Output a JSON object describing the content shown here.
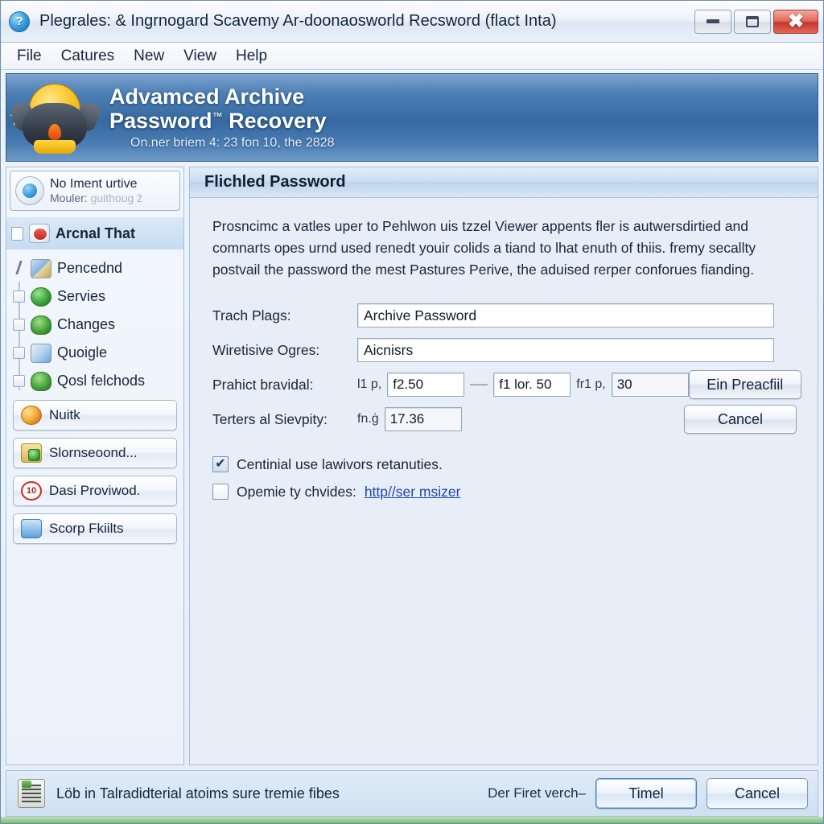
{
  "window": {
    "title": "Plegrales: & Ingrnogard Scavemy Ar-doonaosworld Recsword (flact Inta)",
    "app_icon": "question-mark-icon",
    "minimize_label": "Minimize",
    "restore_label": "Restore",
    "close_label": "Close"
  },
  "menu": {
    "items": [
      {
        "label": "File"
      },
      {
        "label": "Catures"
      },
      {
        "label": "New"
      },
      {
        "label": "View"
      },
      {
        "label": "Help"
      }
    ]
  },
  "banner": {
    "line1": "Advamced Archive",
    "line2": "Password",
    "trademark": "™",
    "line2_tail": " Recovery",
    "subtitle": "On.ner briem 4: 23 fon 10, the 2828"
  },
  "sidebar": {
    "status": {
      "line1": "No Iment urtive",
      "line2_label": "Mouler:",
      "line2_value": "ɡuithouɡ ž"
    },
    "tree_header": {
      "label": "Arcnal That",
      "icon": "stop-sign-icon"
    },
    "tree_items": [
      {
        "label": "Pencednd",
        "icon": "picture-icon"
      },
      {
        "label": "Servies",
        "icon": "globe-icon"
      },
      {
        "label": "Changes",
        "icon": "frog-icon"
      },
      {
        "label": "Quoigle",
        "icon": "image-icon"
      },
      {
        "label": "Qosl felchods",
        "icon": "frog-icon"
      }
    ],
    "buttons": [
      {
        "label": "Nuitk",
        "icon": "multi-color-icon"
      },
      {
        "label": "Slornseoond...",
        "icon": "download-icon"
      },
      {
        "label": "Dasi Proviwod.",
        "icon": "clock-icon"
      },
      {
        "label": "Scorp Fkiilts",
        "icon": "scope-icon"
      }
    ]
  },
  "main": {
    "panel_title": "Flichled Password",
    "paragraph": "Prosncimc a vatles uper to Pehlwon uis tzzel Viewer appents fler is autwersdirtied and comnarts opes urnd used renedt youir colids a tiand to lhat enuth of thiis. fremy secallty postvail the password the mest Pastures Perive, the aduised rerper conforues fianding.",
    "fields": [
      {
        "label": "Trach Plags:",
        "value": "Archive Password",
        "placeholder": ""
      },
      {
        "label": "Wiretisive Ogres:",
        "value": "Aicnisrs",
        "placeholder": ""
      }
    ],
    "range_row": {
      "label": "Prahict bravidal:",
      "prefix1": "l1 p,",
      "value1": "f2.50",
      "separator": "—",
      "prefix2": "",
      "value2": "f1 lor. 50",
      "prefix3": "fr1 p,",
      "value3": "30"
    },
    "interval_row": {
      "label": "Terters al Sievpity:",
      "prefix": "fn.ġ",
      "value": "17.36"
    },
    "action_buttons": [
      {
        "label": "Ein Preacfiil"
      },
      {
        "label": "Cancel"
      }
    ],
    "checkboxes": [
      {
        "label": "Centinial use lawivors retanuties.",
        "checked": true,
        "check_glyph": "✔"
      },
      {
        "label": "Opemie ty chvides:",
        "checked": false,
        "link": "http//ser msizer"
      }
    ]
  },
  "statusbar": {
    "icon": "clipboard-icon",
    "text": "Löb in Talradidterial atoims sure tremie fibes",
    "note": "Der Firet verch–",
    "buttons": [
      {
        "label": "Timel",
        "primary": true
      },
      {
        "label": "Cancel",
        "primary": false
      }
    ]
  }
}
